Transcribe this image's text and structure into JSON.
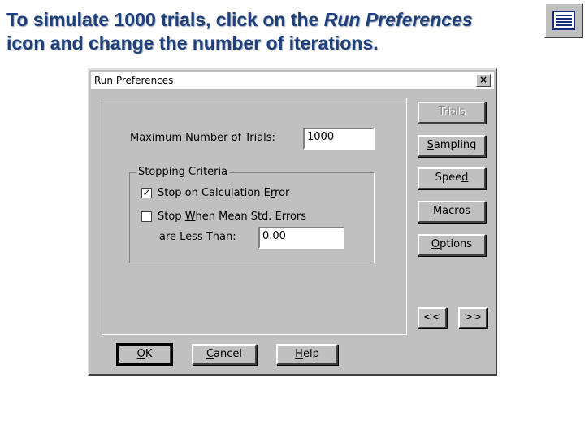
{
  "instruction": {
    "part1": "To simulate 1000 trials, click on the ",
    "emph": "Run Preferences",
    "part2": "icon and change the number of iterations."
  },
  "toolbar": {
    "icon": "run-preferences-icon"
  },
  "dialog": {
    "title": "Run Preferences",
    "close_label": "×",
    "max_trials_label": "Maximum Number of Trials:",
    "max_trials_value": "1000",
    "stopping_criteria_title": "Stopping Criteria",
    "stop_on_calc_error": {
      "label_pre": "Stop on Calculation E",
      "label_u": "r",
      "label_post": "ror",
      "checked": true,
      "mark": "✓"
    },
    "stop_when_mean": {
      "label_pre": "Stop ",
      "label_u": "W",
      "label_post": "hen Mean Std. Errors",
      "checked": false
    },
    "less_than_label": "are Less Than:",
    "less_than_value": "0.00",
    "side_buttons": {
      "trials": "Trials",
      "sampling_u": "S",
      "sampling_rest": "ampling",
      "speed_pre": "Spee",
      "speed_u": "d",
      "macros_u": "M",
      "macros_rest": "acros",
      "options_pre": "O",
      "options_rest": "ptions",
      "prev": "<<",
      "next": ">>"
    },
    "bottom_buttons": {
      "ok_u": "O",
      "ok_rest": "K",
      "cancel_u": "C",
      "cancel_rest": "ancel",
      "help_u": "H",
      "help_rest": "elp"
    }
  }
}
